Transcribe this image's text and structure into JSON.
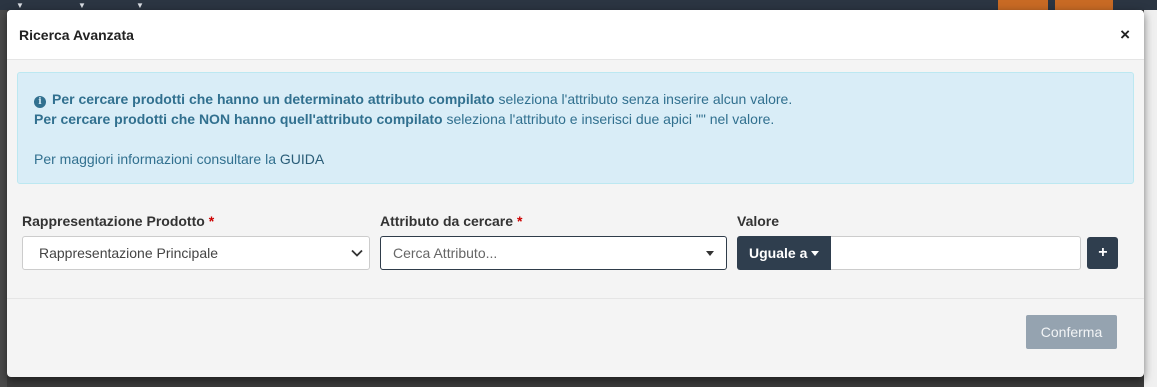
{
  "modal": {
    "title": "Ricerca Avanzata",
    "close_label": "×"
  },
  "alert": {
    "line1_bold": "Per cercare prodotti che hanno un determinato attributo compilato",
    "line1_rest": " seleziona l'attributo senza inserire alcun valore.",
    "line2_bold": "Per cercare prodotti che NON hanno quell'attributo compilato",
    "line2_rest": " seleziona l'attributo e inserisci due apici \"\" nel valore.",
    "line3_text": "Per maggiori informazioni consultare la ",
    "line3_link": "GUIDA"
  },
  "form": {
    "rappresentazione": {
      "label": "Rappresentazione Prodotto",
      "required_mark": "*",
      "selected": "Rappresentazione Principale"
    },
    "attributo": {
      "label": "Attributo da cercare",
      "required_mark": "*",
      "placeholder": "Cerca Attributo..."
    },
    "valore": {
      "label": "Valore",
      "operator": "Uguale a",
      "value": ""
    },
    "add_label": "+"
  },
  "footer": {
    "confirm_label": "Conferma"
  },
  "colors": {
    "alert_bg": "#d9edf7",
    "alert_text": "#31708f",
    "dark_button": "#2f3e4e",
    "confirm_button": "#95a3b0",
    "required": "#cc0000"
  },
  "icons": [
    "info-icon",
    "close-icon",
    "chevron-down-icon",
    "caret-down-icon",
    "plus-icon"
  ]
}
